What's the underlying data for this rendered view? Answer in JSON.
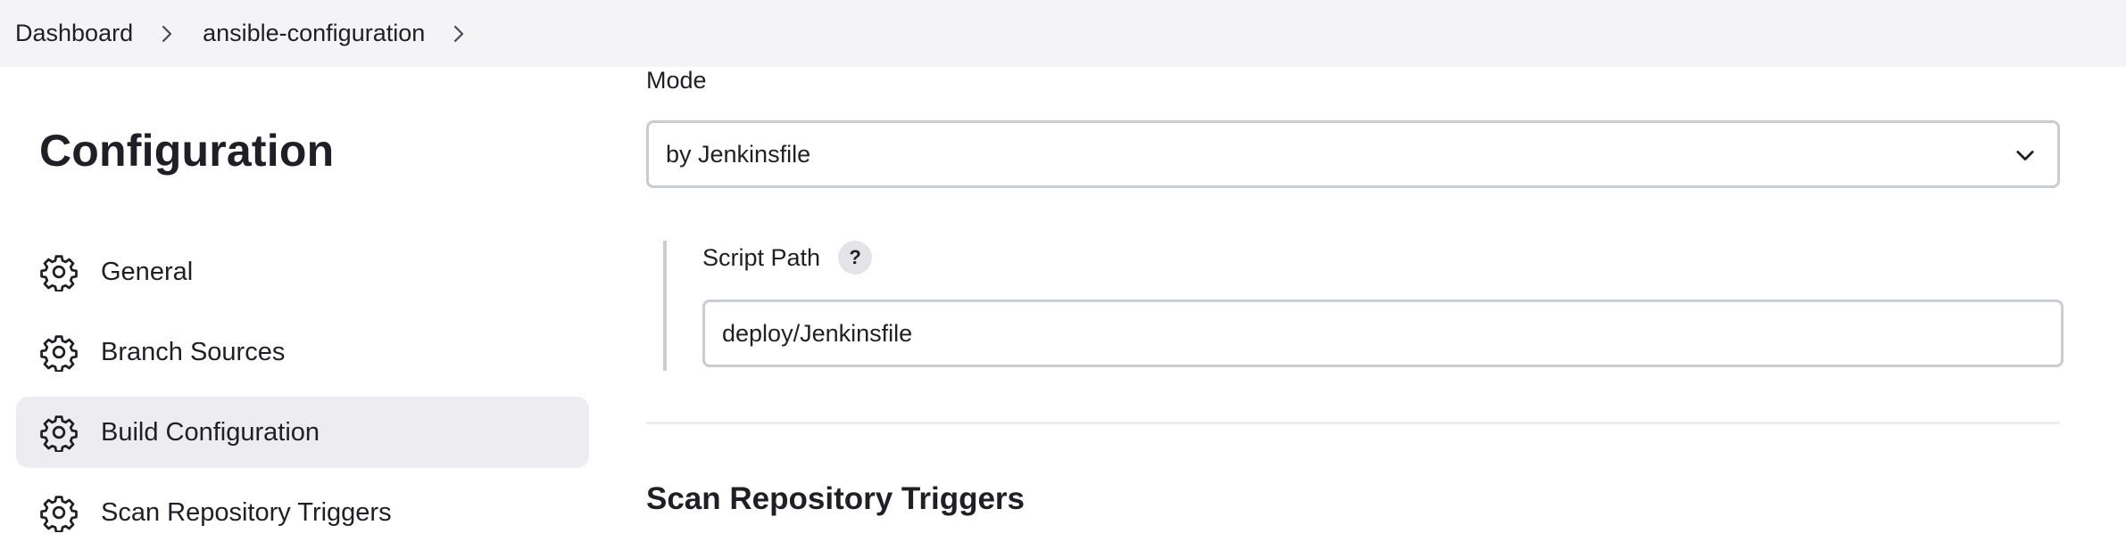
{
  "breadcrumb": {
    "items": [
      {
        "label": "Dashboard"
      },
      {
        "label": "ansible-configuration"
      }
    ]
  },
  "sidebar": {
    "title": "Configuration",
    "items": [
      {
        "label": "General",
        "icon": "gear-icon",
        "active": false
      },
      {
        "label": "Branch Sources",
        "icon": "gear-icon",
        "active": false
      },
      {
        "label": "Build Configuration",
        "icon": "gear-icon",
        "active": true
      },
      {
        "label": "Scan Repository Triggers",
        "icon": "gear-icon",
        "active": false
      }
    ]
  },
  "build_configuration": {
    "mode_label": "Mode",
    "mode_value": "by Jenkinsfile",
    "script_path_label": "Script Path",
    "help_label": "?",
    "script_path_value": "deploy/Jenkinsfile"
  },
  "next_section": {
    "title": "Scan Repository Triggers"
  },
  "colors": {
    "topbar_bg": "#f4f4f6",
    "active_nav_bg": "#ececf1",
    "border": "#c9ccd1",
    "text": "#1f1f26"
  }
}
